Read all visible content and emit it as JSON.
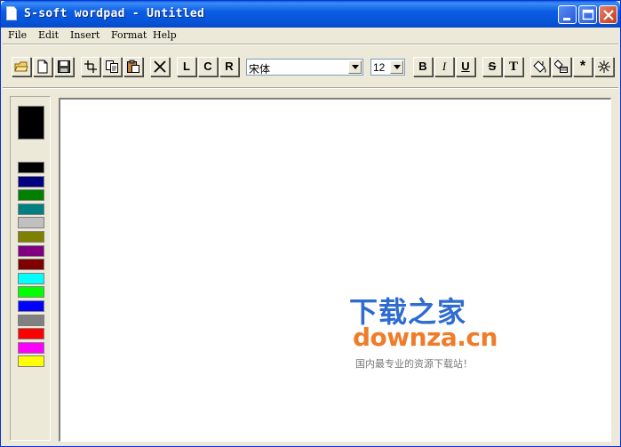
{
  "window": {
    "title": "S-soft wordpad - Untitled"
  },
  "menu": {
    "items": [
      "File",
      "Edit",
      "Insert",
      "Format",
      "Help"
    ]
  },
  "toolbar": {
    "align_left": "L",
    "align_center": "C",
    "align_right": "R",
    "font_name": "宋体",
    "font_size": "12",
    "bold": "B",
    "italic": "I",
    "underline": "U",
    "strike": "S",
    "text_style": "T",
    "special": "*"
  },
  "palette": {
    "current": "#000000",
    "colors": [
      "#000000",
      "#000080",
      "#008000",
      "#008080",
      "#c0c0c0",
      "#808000",
      "#800080",
      "#800000",
      "#00ffff",
      "#00ff00",
      "#0000ff",
      "#808080",
      "#ff0000",
      "#ff00ff",
      "#ffff00"
    ]
  },
  "editor": {
    "content": ""
  },
  "watermark": {
    "title": "下载之家",
    "domain": "downza.cn",
    "slogan": "国内最专业的资源下载站！"
  },
  "icons": {
    "app": "document-icon",
    "minimize": "minimize-icon",
    "maximize": "maximize-icon",
    "close": "close-icon",
    "open": "open-folder-icon",
    "new": "new-document-icon",
    "save": "save-disk-icon",
    "cut": "cut-icon",
    "copy": "copy-icon",
    "paste": "paste-icon",
    "delete": "delete-x-icon",
    "paint": "paint-bucket-icon",
    "picture": "insert-picture-icon",
    "special": "asterisk-icon",
    "sparkle": "sparkle-icon"
  }
}
